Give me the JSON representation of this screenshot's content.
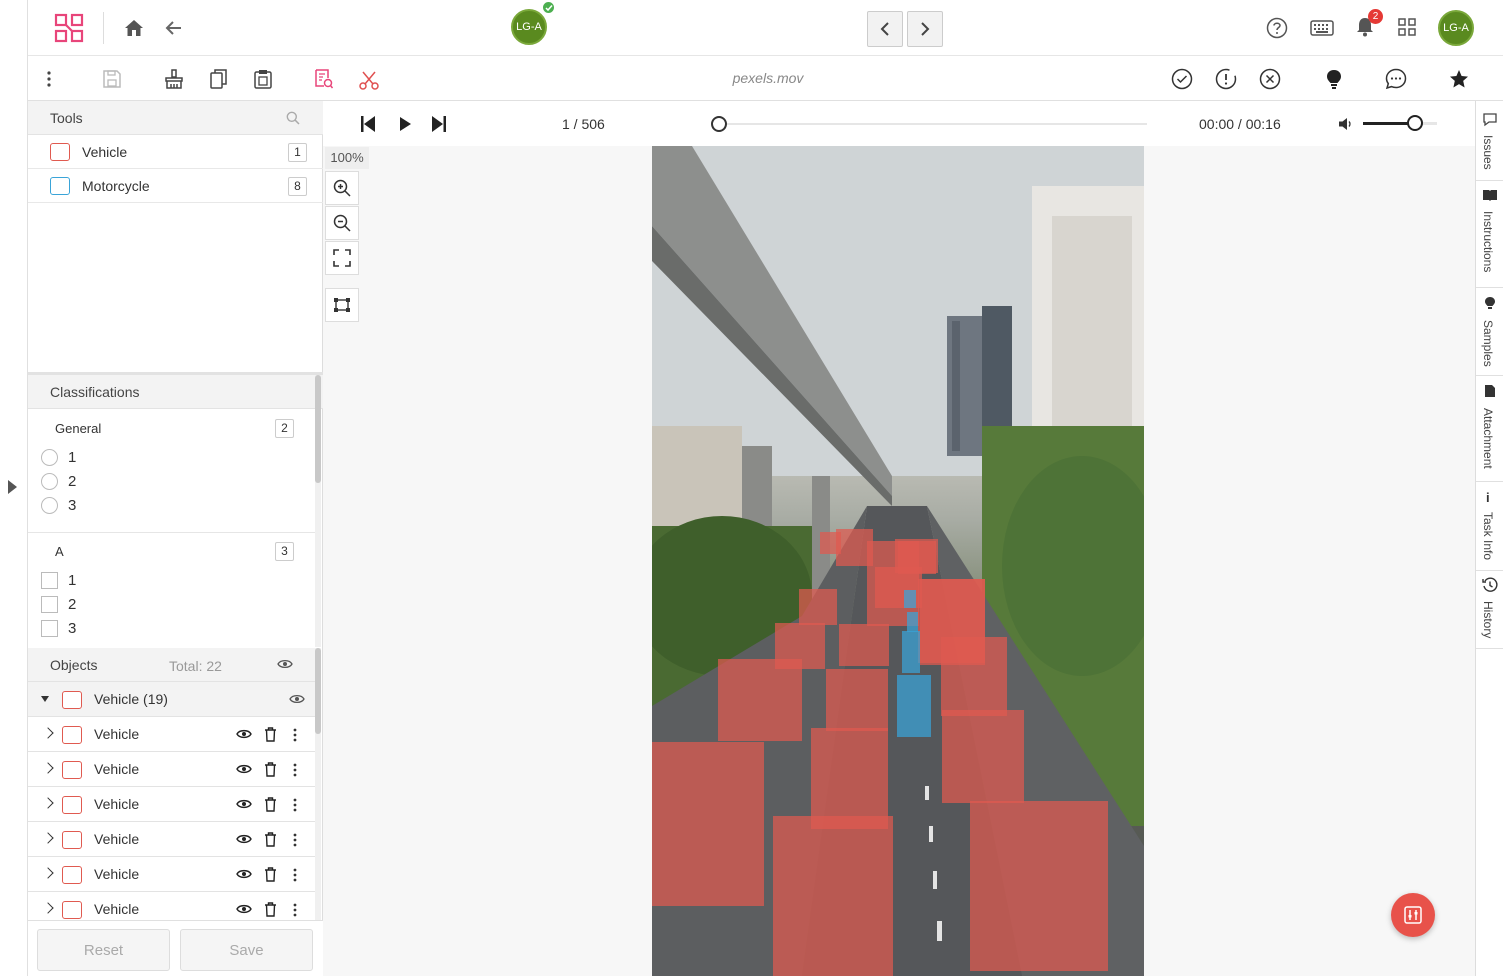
{
  "header": {
    "user_initials": "LG-A",
    "notification_count": "2"
  },
  "toolbar": {
    "filename": "pexels.mov"
  },
  "tools": {
    "title": "Tools",
    "items": [
      {
        "label": "Vehicle",
        "count": "1",
        "color": "#e05a50"
      },
      {
        "label": "Motorcycle",
        "count": "8",
        "color": "#3aa4d8"
      }
    ]
  },
  "classifications": {
    "title": "Classifications",
    "groups": [
      {
        "label": "General",
        "count": "2",
        "type": "radio",
        "options": [
          "1",
          "2",
          "3"
        ]
      },
      {
        "label": "A",
        "count": "3",
        "type": "checkbox",
        "options": [
          "1",
          "2",
          "3"
        ]
      }
    ]
  },
  "objects": {
    "title": "Objects",
    "total": "Total: 22",
    "group_label": "Vehicle (19)",
    "rows": [
      "Vehicle",
      "Vehicle",
      "Vehicle",
      "Vehicle",
      "Vehicle",
      "Vehicle"
    ]
  },
  "actions": {
    "reset": "Reset",
    "save": "Save"
  },
  "player": {
    "frame": "1 / 506",
    "time": "00:00 / 00:16",
    "progress": 0.0,
    "volume": 0.7
  },
  "zoom": {
    "level": "100%"
  },
  "annotations": {
    "vehicle_color": "#e05a50",
    "motorcycle_color": "#3aa4d8"
  },
  "right_rail": {
    "items": [
      "Issues",
      "Instructions",
      "Samples",
      "Attachment",
      "Task Info",
      "History"
    ]
  }
}
